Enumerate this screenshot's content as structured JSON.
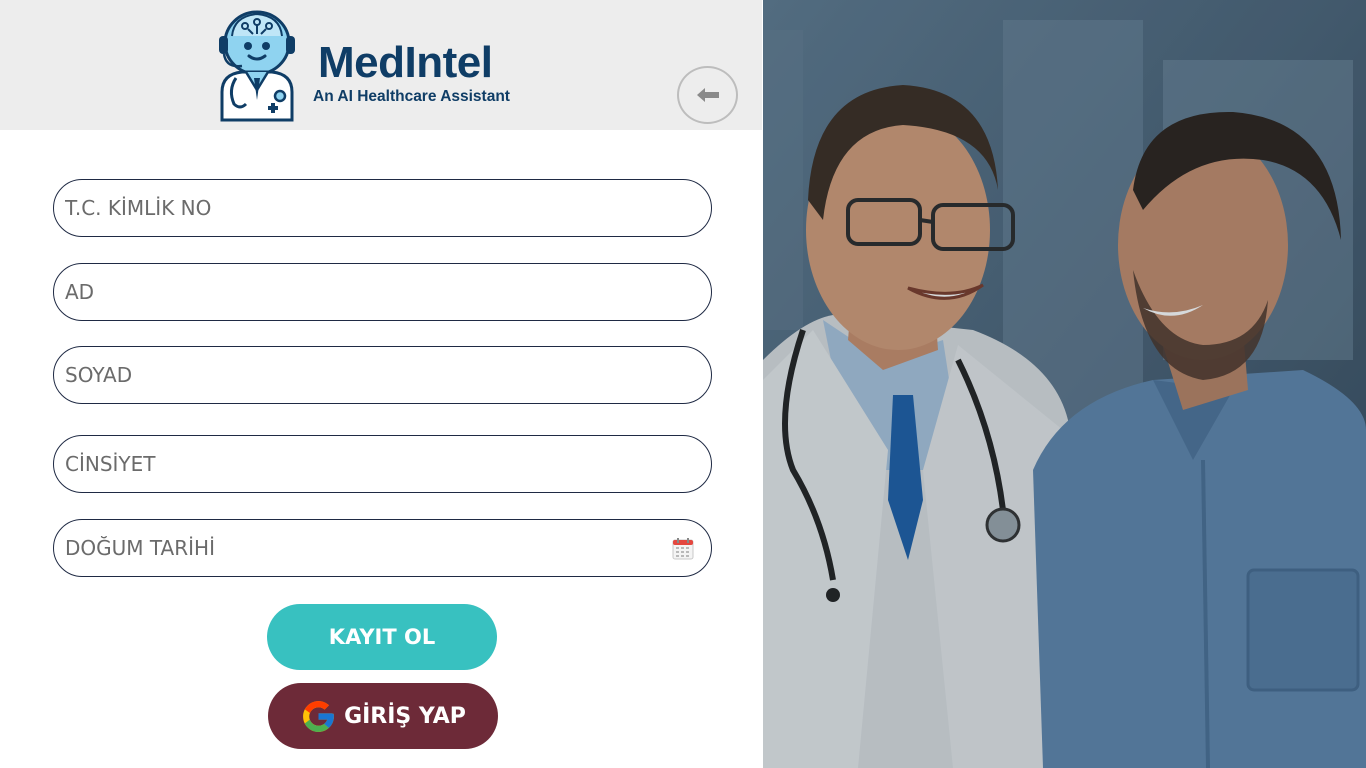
{
  "brand": {
    "name": "MedIntel",
    "tagline": "An AI Healthcare Assistant"
  },
  "colors": {
    "brand_navy": "#0f3d66",
    "register_button": "#38c1c0",
    "login_button": "#6d2a38",
    "header_background": "#ededed"
  },
  "form": {
    "tc_kimlik": {
      "placeholder": "T.C. KİMLİK NO",
      "value": ""
    },
    "ad": {
      "placeholder": "AD",
      "value": ""
    },
    "soyad": {
      "placeholder": "SOYAD",
      "value": ""
    },
    "cinsiyet": {
      "placeholder": "CİNSİYET",
      "value": ""
    },
    "dogum_tarihi": {
      "placeholder": "DOĞUM TARİHİ",
      "value": ""
    }
  },
  "buttons": {
    "register_label": "KAYIT OL",
    "login_label": "GİRİŞ YAP"
  },
  "icons": {
    "back": "arrow-left-icon",
    "calendar": "calendar-icon",
    "google": "google-icon",
    "logo": "robot-doctor-logo"
  }
}
